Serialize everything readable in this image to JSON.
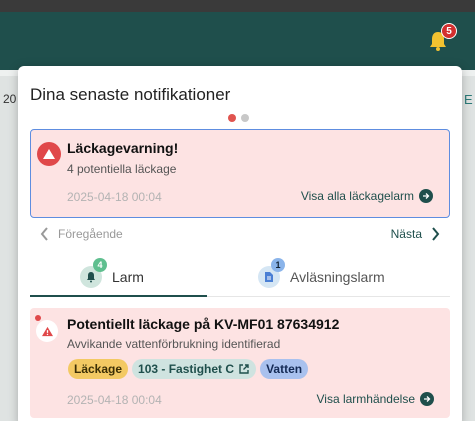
{
  "header": {
    "notification_count": "5"
  },
  "background": {
    "left_text": "20",
    "right_text": "E"
  },
  "panel": {
    "title": "Dina senaste notifikationer",
    "carousel": {
      "card": {
        "title": "Läckagevarning!",
        "subtitle": "4 potentiella läckage",
        "date": "2025-04-18 00:04",
        "link": "Visa alla läckagelarm"
      },
      "prev_label": "Föregående",
      "next_label": "Nästa"
    },
    "tabs": [
      {
        "label": "Larm",
        "badge": "4"
      },
      {
        "label": "Avläsningslarm",
        "badge": "1"
      }
    ],
    "alarm": {
      "title": "Potentiellt läckage på KV-MF01 87634912",
      "subtitle": "Avvikande vattenförbrukning identifierad",
      "tags": [
        "Läckage",
        "103 - Fastighet C",
        "Vatten"
      ],
      "date": "2025-04-18 00:04",
      "link": "Visa larmhändelse"
    }
  },
  "colors": {
    "header": "#1f4f4c",
    "accent": "#1f4f4c",
    "danger": "#e0484a",
    "card_bg": "#fde3e3"
  }
}
